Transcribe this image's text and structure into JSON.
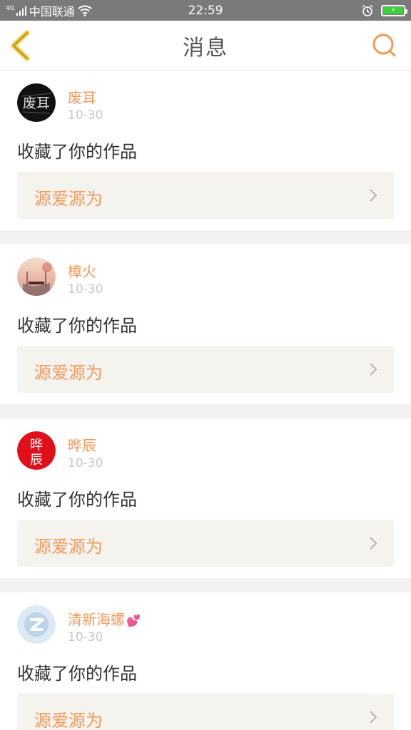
{
  "status_bar": {
    "network_tag": "4G",
    "carrier": "中国联通",
    "time": "22:59"
  },
  "header": {
    "title": "消息",
    "accent": "#f2995a",
    "back_color": "#f3c93e"
  },
  "messages": [
    {
      "user": "废耳",
      "date": "10-30",
      "action": "收藏了你的作品",
      "work_title": "源爱源为",
      "avatar_text": "废耳"
    },
    {
      "user": "樟火",
      "date": "10-30",
      "action": "收藏了你的作品",
      "work_title": "源爱源为"
    },
    {
      "user": "晔辰",
      "date": "10-30",
      "action": "收藏了你的作品",
      "work_title": "源爱源为",
      "avatar_text_top": "晔",
      "avatar_text_bottom": "辰"
    },
    {
      "user": "清新海螺",
      "date": "10-30",
      "action": "收藏了你的作品",
      "work_title": "源爱源为"
    }
  ]
}
